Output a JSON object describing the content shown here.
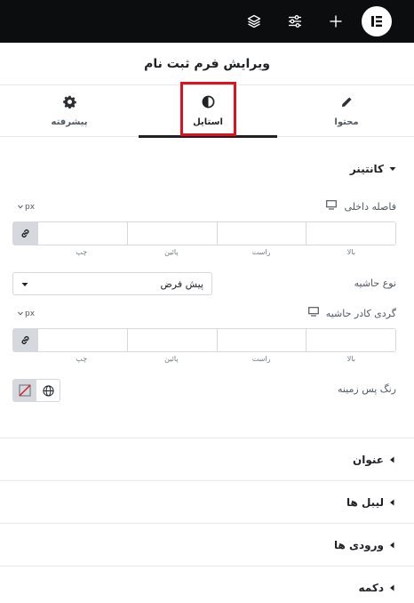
{
  "topbar": {
    "icons": [
      "layers-icon",
      "sliders-icon",
      "plus-icon",
      "elementor-logo"
    ]
  },
  "header": {
    "title": "ویرایش فرم ثبت نام"
  },
  "tabs": [
    {
      "label": "پیشرفته",
      "icon": "gear-icon"
    },
    {
      "label": "استایل",
      "icon": "half-circle-icon",
      "active": true
    },
    {
      "label": "محتوا",
      "icon": "pencil-icon"
    }
  ],
  "section": {
    "title": "کانتینر",
    "padding": {
      "label": "فاصله داخلی",
      "unit": "px",
      "sides": [
        "بالا",
        "راست",
        "پائین",
        "چپ"
      ]
    },
    "border_type": {
      "label": "نوع حاشیه",
      "value": "پیش فرض"
    },
    "border_radius": {
      "label": "گردی کادر حاشیه",
      "unit": "px",
      "sides": [
        "بالا",
        "راست",
        "پائین",
        "چپ"
      ]
    },
    "background": {
      "label": "رنگ پس زمینه"
    }
  },
  "accordions": [
    "عنوان",
    "لیبل ها",
    "ورودی ها",
    "دکمه"
  ],
  "colors": {
    "topbar": "#0c0d0e",
    "highlight": "#e0101f",
    "border": "#d5d8dc"
  }
}
